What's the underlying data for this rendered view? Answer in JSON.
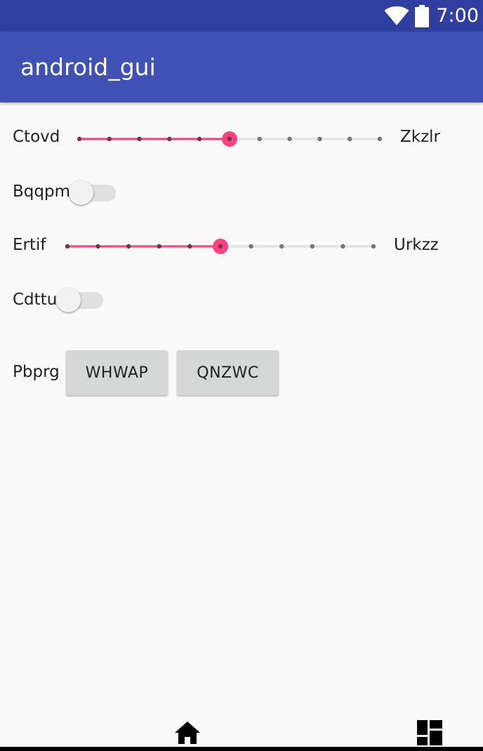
{
  "status_bar": {
    "time": "7:00",
    "wifi_icon": "wifi-icon",
    "battery_icon": "battery-icon"
  },
  "app_bar": {
    "title": "android_gui"
  },
  "rows": {
    "slider1": {
      "label": "Ctovd",
      "end_label": "Zkzlr",
      "ticks": 11,
      "value_index": 5
    },
    "switch1": {
      "label": "Bqqpm",
      "checked": false
    },
    "slider2": {
      "label": "Ertif",
      "end_label": "Urkzz",
      "ticks": 11,
      "value_index": 5
    },
    "switch2": {
      "label": "Cdttu",
      "checked": false
    },
    "buttons_row": {
      "label": "Pbprg",
      "button1": "WHWAP",
      "button2": "QNZWC"
    }
  },
  "nav_bar": {
    "home_icon": "home-icon",
    "recents_icon": "recents-icon"
  },
  "colors": {
    "status_bar": "#303f9f",
    "app_bar": "#3f51b5",
    "accent": "#ff4081",
    "background": "#fafafa"
  }
}
